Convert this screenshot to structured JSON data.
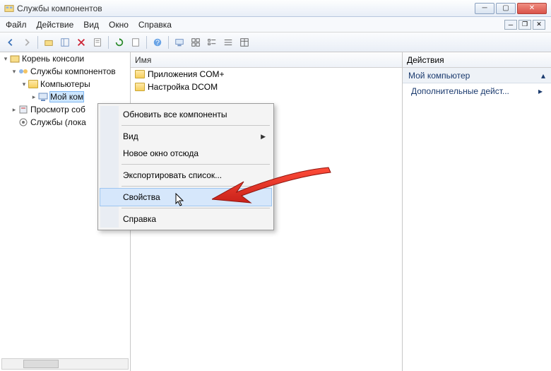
{
  "title": "Службы компонентов",
  "menus": [
    "Файл",
    "Действие",
    "Вид",
    "Окно",
    "Справка"
  ],
  "tree": {
    "root": "Корень консоли",
    "items": [
      "Службы компонентов",
      "Компьютеры",
      "Мой ком",
      "Просмотр соб",
      "Службы (лока"
    ]
  },
  "list": {
    "column": "Имя",
    "rows": [
      "Приложения COM+",
      "Настройка DCOM"
    ]
  },
  "actions": {
    "title": "Действия",
    "subject": "Мой компьютер",
    "more": "Дополнительные дейст..."
  },
  "context": {
    "refresh_all": "Обновить все компоненты",
    "view": "Вид",
    "new_window": "Новое окно отсюда",
    "export": "Экспортировать список...",
    "properties": "Свойства",
    "help": "Справка"
  }
}
